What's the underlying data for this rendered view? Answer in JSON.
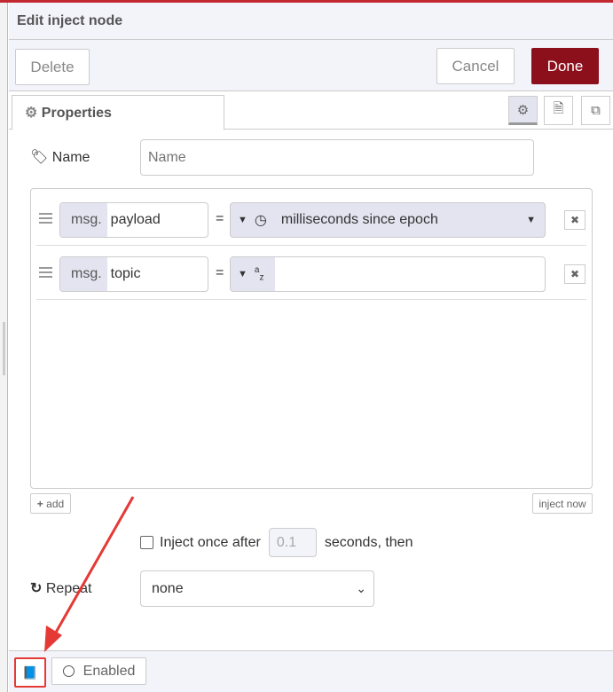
{
  "header": {
    "title": "Edit inject node"
  },
  "toolbar": {
    "delete": "Delete",
    "cancel": "Cancel",
    "done": "Done"
  },
  "tabs": {
    "properties": "Properties"
  },
  "form": {
    "name_label": "Name",
    "name_placeholder": "Name",
    "name_value": "",
    "rows": [
      {
        "prefix": "msg.",
        "property": "payload",
        "eq": "=",
        "type_icon": "clock-icon",
        "value": "milliseconds since epoch"
      },
      {
        "prefix": "msg.",
        "property": "topic",
        "eq": "=",
        "type_icon": "string-az-icon",
        "value": ""
      }
    ],
    "add": "add",
    "inject_now": "inject now",
    "inject_once": "Inject once after",
    "delay_placeholder": "0.1",
    "seconds_then": "seconds, then",
    "repeat_label": "Repeat",
    "repeat_value": "none"
  },
  "footer": {
    "enabled": "Enabled"
  },
  "colors": {
    "done": "#8c101c",
    "annotation": "#e53935"
  }
}
